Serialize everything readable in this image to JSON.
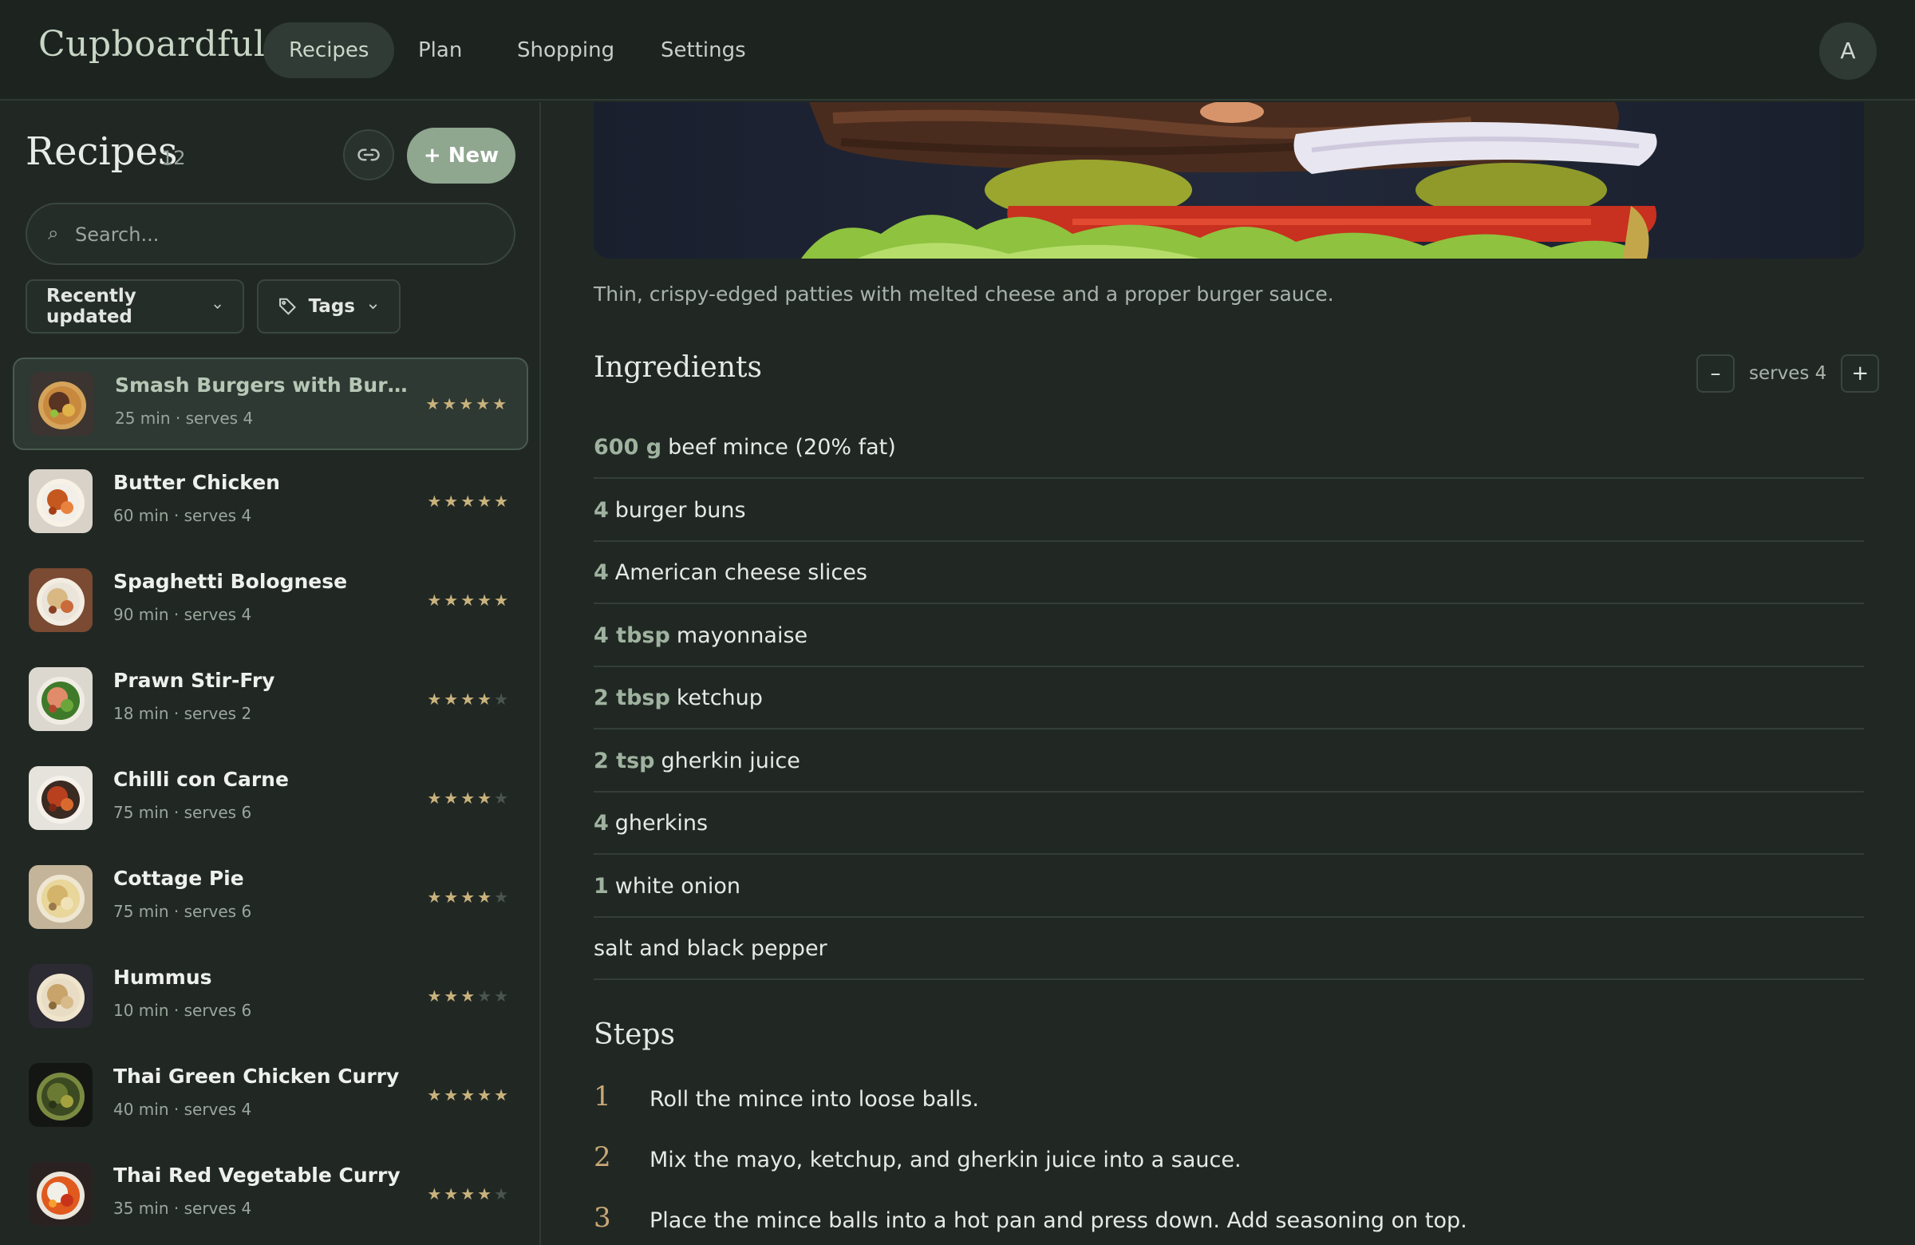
{
  "app": {
    "brand": "Cupboardful",
    "nav": [
      "Recipes",
      "Plan",
      "Shopping",
      "Settings"
    ],
    "active_nav": "Recipes",
    "avatar_initial": "A"
  },
  "sidebar": {
    "title": "Recipes",
    "count": "12",
    "new_label": "+ New",
    "search_placeholder": "Search...",
    "sort_label": "Recently updated",
    "tags_label": "Tags",
    "recipes": [
      {
        "name": "Smash Burgers with Burger Sa...",
        "meta": "25 min · serves 4",
        "rating": 5,
        "thumb": "burger-thumbnail",
        "selected": true
      },
      {
        "name": "Butter Chicken",
        "meta": "60 min · serves 4",
        "rating": 5,
        "thumb": "butter-chicken-thumbnail"
      },
      {
        "name": "Spaghetti Bolognese",
        "meta": "90 min · serves 4",
        "rating": 5,
        "thumb": "bolognese-thumbnail"
      },
      {
        "name": "Prawn Stir-Fry",
        "meta": "18 min · serves 2",
        "rating": 4,
        "thumb": "stir-fry-thumbnail"
      },
      {
        "name": "Chilli con Carne",
        "meta": "75 min · serves 6",
        "rating": 4,
        "thumb": "chilli-thumbnail"
      },
      {
        "name": "Cottage Pie",
        "meta": "75 min · serves 6",
        "rating": 4,
        "thumb": "cottage-pie-thumbnail"
      },
      {
        "name": "Hummus",
        "meta": "10 min · serves 6",
        "rating": 3,
        "thumb": "hummus-thumbnail"
      },
      {
        "name": "Thai Green Chicken Curry",
        "meta": "40 min · serves 4",
        "rating": 5,
        "thumb": "green-curry-thumbnail"
      },
      {
        "name": "Thai Red Vegetable Curry",
        "meta": "35 min · serves 4",
        "rating": 4,
        "thumb": "red-curry-thumbnail"
      }
    ]
  },
  "recipe": {
    "description": "Thin, crispy-edged patties with melted cheese and a proper burger sauce.",
    "ingredients_title": "Ingredients",
    "serves_label": "serves 4",
    "minus_label": "–",
    "plus_label": "+",
    "ingredients": [
      {
        "qty": "600 g",
        "item": "beef mince (20% fat)"
      },
      {
        "qty": "4",
        "item": "burger buns"
      },
      {
        "qty": "4",
        "item": "American cheese slices"
      },
      {
        "qty": "4 tbsp",
        "item": "mayonnaise"
      },
      {
        "qty": "2 tbsp",
        "item": "ketchup"
      },
      {
        "qty": "2 tsp",
        "item": "gherkin juice"
      },
      {
        "qty": "4",
        "item": "gherkins"
      },
      {
        "qty": "1",
        "item": "white onion"
      },
      {
        "qty": "",
        "item": "salt and black pepper"
      }
    ],
    "steps_title": "Steps",
    "steps": [
      {
        "num": "1",
        "text": "Roll the mince into loose balls."
      },
      {
        "num": "2",
        "text": "Mix the mayo, ketchup, and gherkin juice into a sauce."
      },
      {
        "num": "3",
        "text": "Place the mince balls into a hot pan and press down. Add seasoning on top."
      }
    ]
  },
  "colors": {
    "background": "#212824",
    "accent": "#8fa68f",
    "star": "#c9b27c",
    "step_number": "#c9a877"
  }
}
